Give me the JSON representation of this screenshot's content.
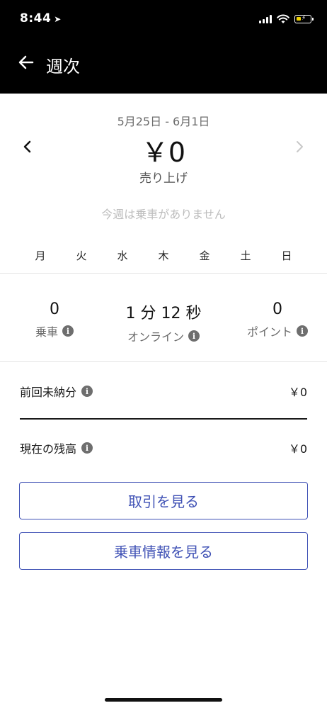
{
  "status_bar": {
    "time": "8:44",
    "battery_color": "#f0d200"
  },
  "header": {
    "title": "週次",
    "back_icon": "arrow-left-icon"
  },
  "summary": {
    "date_range": "5月25日 - 6月1日",
    "amount": "￥0",
    "amount_label": "売り上げ",
    "empty_message": "今週は乗車がありません"
  },
  "weekdays": [
    "月",
    "火",
    "水",
    "木",
    "金",
    "土",
    "日"
  ],
  "stats": [
    {
      "value": "0",
      "label": "乗車"
    },
    {
      "value": "1 分 12 秒",
      "label": "オンライン"
    },
    {
      "value": "0",
      "label": "ポイント"
    }
  ],
  "balances": [
    {
      "label": "前回未納分",
      "value": "￥0"
    },
    {
      "label": "現在の残高",
      "value": "￥0"
    }
  ],
  "buttons": {
    "transactions": "取引を見る",
    "ride_info": "乗車情報を見る"
  },
  "colors": {
    "header_bg": "#000000",
    "accent": "#3f51b5",
    "muted": "#bdbdbd"
  }
}
